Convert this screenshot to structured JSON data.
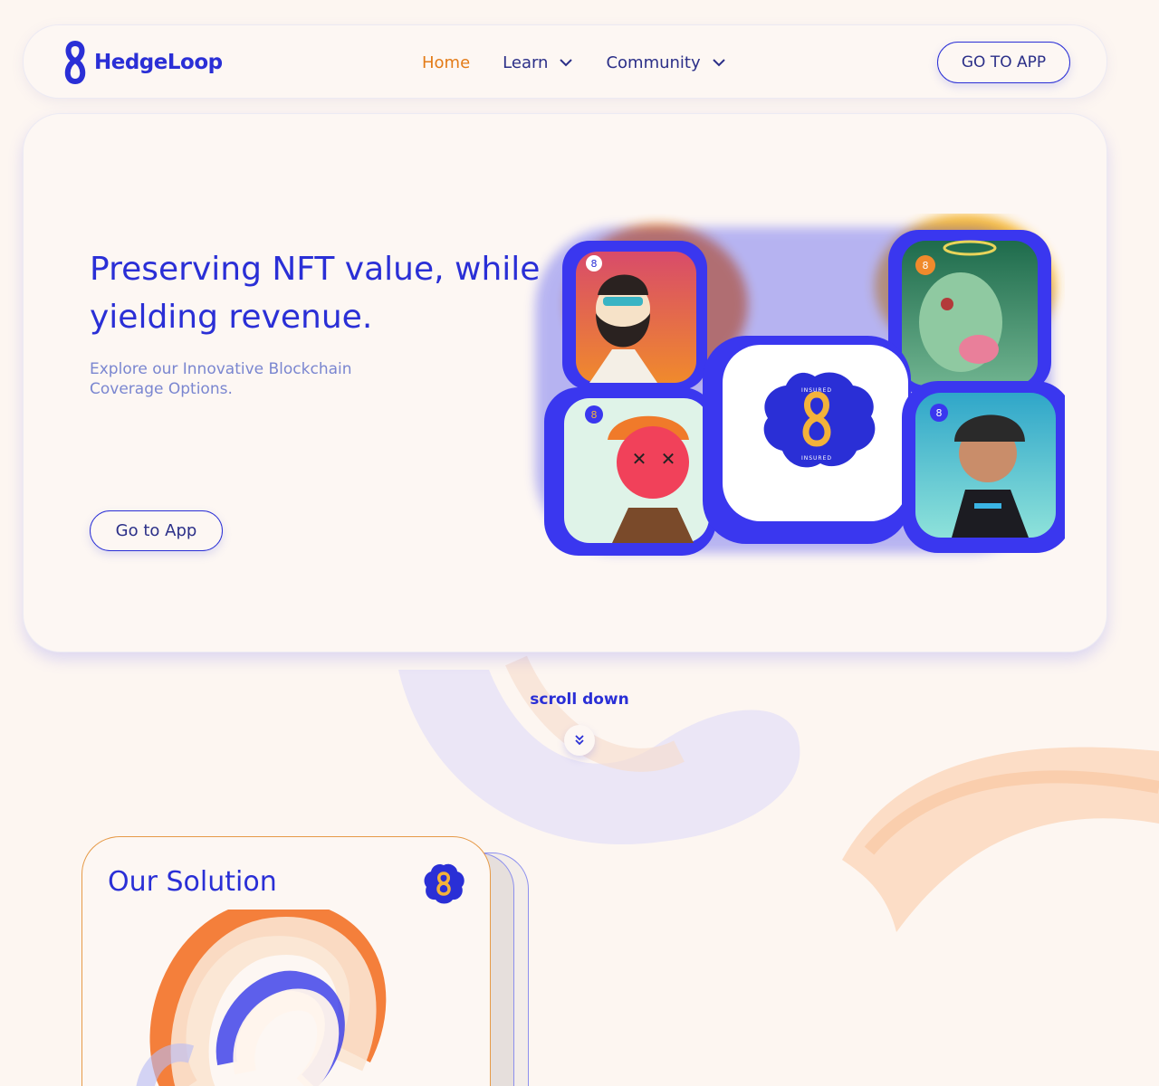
{
  "brand": {
    "name": "HedgeLoop"
  },
  "nav": {
    "links": [
      {
        "label": "Home"
      },
      {
        "label": "Learn"
      },
      {
        "label": "Community"
      }
    ],
    "cta_label": "GO TO APP"
  },
  "hero": {
    "title": "Preserving NFT value, while yielding revenue.",
    "subtitle": "Explore our Innovative Blockchain Coverage Options.",
    "cta_label": "Go to App",
    "badge_text_top": "INSURED",
    "badge_text_bottom": "INSURED"
  },
  "scroll": {
    "label": "scroll down"
  },
  "solution": {
    "title": "Our Solution"
  },
  "colors": {
    "primary": "#2a2fd6",
    "accent": "#e37b17",
    "background": "#fdf6f1"
  }
}
